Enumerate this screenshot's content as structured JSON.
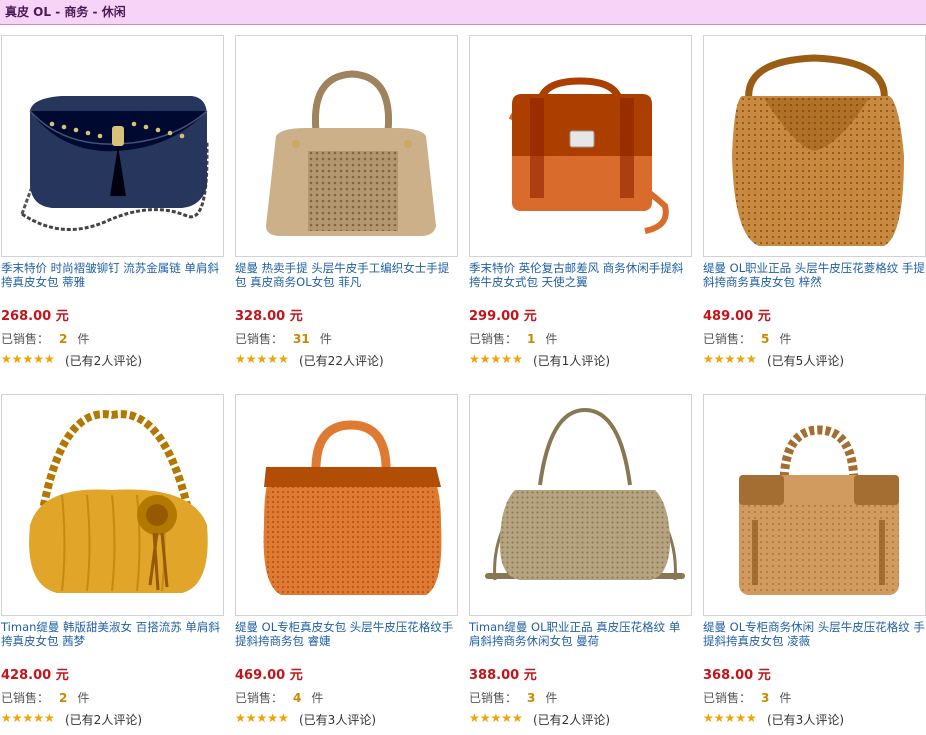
{
  "header": {
    "title": "真皮 OL - 商务 - 休闲"
  },
  "labels": {
    "sold_prefix": "已销售：",
    "sold_unit": "件",
    "star_glyphs": "★★★★★"
  },
  "colors": {
    "header_bg": "#f7d3f7",
    "price": "#c4141a",
    "link": "#1f5fa6",
    "star": "#f2a400",
    "sold_count": "#c78a00"
  },
  "products": [
    {
      "name": "季末特价 时尚褶皱铆钉 流苏金属链 单肩斜挎真皮女包 蒂雅",
      "price": "268.00 元",
      "sold": "2",
      "rating": 5,
      "reviews": "(已有2人评论)",
      "bag_color": "#27365c",
      "style": "clutch-chain"
    },
    {
      "name": "缇曼 热卖手提 头层牛皮手工编织女士手提包 真皮商务OL女包 菲凡",
      "price": "328.00 元",
      "sold": "31",
      "rating": 5,
      "reviews": "(已有22人评论)",
      "bag_color": "#cbb08a",
      "style": "woven-tote"
    },
    {
      "name": "季末特价 英伦复古邮差风 商务休闲手提斜挎牛皮女式包 天使之翼",
      "price": "299.00 元",
      "sold": "1",
      "rating": 5,
      "reviews": "(已有1人评论)",
      "bag_color": "#d96c2c",
      "style": "satchel"
    },
    {
      "name": "缇曼 OL职业正品 头层牛皮压花菱格纹 手提斜挎商务真皮女包 梓然",
      "price": "489.00 元",
      "sold": "5",
      "rating": 5,
      "reviews": "(已有5人评论)",
      "bag_color": "#c88940",
      "style": "pleat-tote"
    },
    {
      "name": "Timan缇曼 韩版甜美淑女 百搭流苏 单肩斜挎真皮女包 茜梦",
      "price": "428.00 元",
      "sold": "2",
      "rating": 5,
      "reviews": "(已有2人评论)",
      "bag_color": "#e0a529",
      "style": "hobo-flower"
    },
    {
      "name": "缇曼 OL专柜真皮女包 头层牛皮压花格纹手提斜挎商务包 睿婕",
      "price": "469.00 元",
      "sold": "4",
      "rating": 5,
      "reviews": "(已有3人评论)",
      "bag_color": "#df7a33",
      "style": "frame-tote"
    },
    {
      "name": "Timan缇曼 OL职业正品 真皮压花格纹 单肩斜挎商务休闲女包 曼荷",
      "price": "388.00 元",
      "sold": "3",
      "rating": 4.5,
      "reviews": "(已有2人评论)",
      "bag_color": "#b5a47f",
      "style": "perforated-shoulder"
    },
    {
      "name": "缇曼 OL专柜商务休闲 头层牛皮压花格纹 手提斜挎真皮女包 凌薇",
      "price": "368.00 元",
      "sold": "3",
      "rating": 5,
      "reviews": "(已有3人评论)",
      "bag_color": "#d19a5e",
      "style": "braided-tote"
    }
  ]
}
